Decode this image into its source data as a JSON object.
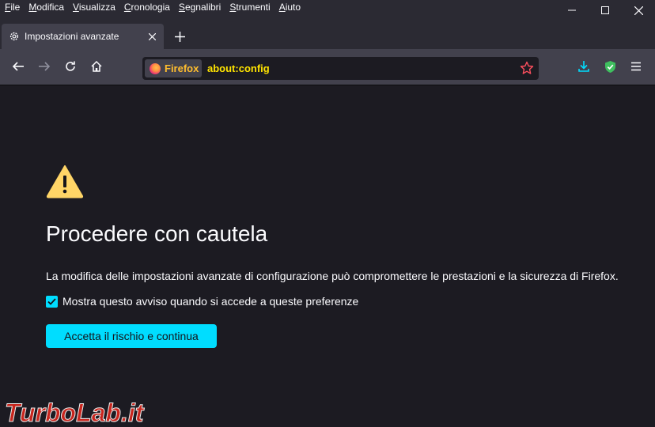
{
  "menubar": {
    "items": [
      "File",
      "Modifica",
      "Visualizza",
      "Cronologia",
      "Segnalibri",
      "Strumenti",
      "Aiuto"
    ]
  },
  "tab": {
    "title": "Impostazioni avanzate"
  },
  "urlbar": {
    "identity_label": "Firefox",
    "url": "about:config"
  },
  "content": {
    "heading": "Procedere con cautela",
    "description": "La modifica delle impostazioni avanzate di configurazione può compromettere le prestazioni e la sicurezza di Firefox.",
    "checkbox_label": "Mostra questo avviso quando si accede a queste preferenze",
    "checkbox_checked": true,
    "accept_button": "Accetta il rischio e continua"
  },
  "watermark": {
    "text": "TurboLab.it"
  },
  "colors": {
    "accent": "#00ddff",
    "warning": "#ffd567",
    "background": "#1c1b22",
    "toolbar": "#42414d"
  }
}
